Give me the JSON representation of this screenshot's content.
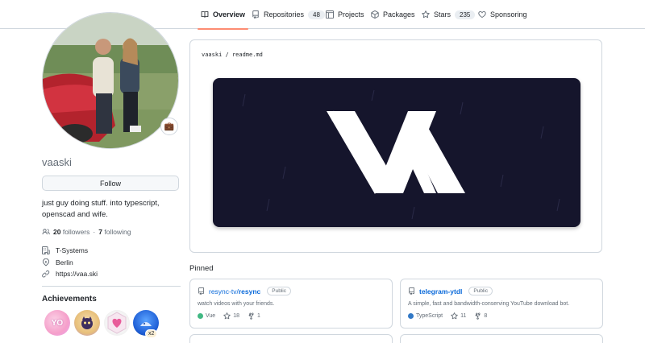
{
  "tabs": [
    {
      "label": "Overview",
      "icon": "book-icon",
      "count": null,
      "active": true
    },
    {
      "label": "Repositories",
      "icon": "repo-icon",
      "count": "48"
    },
    {
      "label": "Projects",
      "icon": "table-icon",
      "count": null
    },
    {
      "label": "Packages",
      "icon": "package-icon",
      "count": null
    },
    {
      "label": "Stars",
      "icon": "star-icon",
      "count": "235"
    },
    {
      "label": "Sponsoring",
      "icon": "heart-icon",
      "count": null
    }
  ],
  "profile": {
    "username": "vaaski",
    "follow_label": "Follow",
    "bio": "just guy doing stuff. into typescript, openscad and wife.",
    "followers_count": "20",
    "followers_label": "followers",
    "separator": "·",
    "following_count": "7",
    "following_label": "following",
    "company": "T-Systems",
    "location": "Berlin",
    "website": "https://vaa.ski",
    "status_emoji": "💼"
  },
  "achievements": {
    "title": "Achievements",
    "extra_count": "x2"
  },
  "readme": {
    "owner": "vaaski",
    "slash": "/",
    "file": "readme.md"
  },
  "pinned": {
    "title": "Pinned",
    "items": [
      {
        "owner": "resync-tv/",
        "name": "resync",
        "visibility": "Public",
        "description": "watch videos with your friends.",
        "language": "Vue",
        "language_color": "#41b883",
        "stars": "18",
        "forks": "1"
      },
      {
        "owner": "",
        "name": "telegram-ytdl",
        "visibility": "Public",
        "description": "A simple, fast and bandwidth-conserving YouTube download bot.",
        "language": "TypeScript",
        "language_color": "#3178c6",
        "stars": "11",
        "forks": "8"
      }
    ]
  },
  "colors": {
    "accent_underline": "#fd8c73",
    "link": "#0969da",
    "banner_bg": "#15152c"
  }
}
